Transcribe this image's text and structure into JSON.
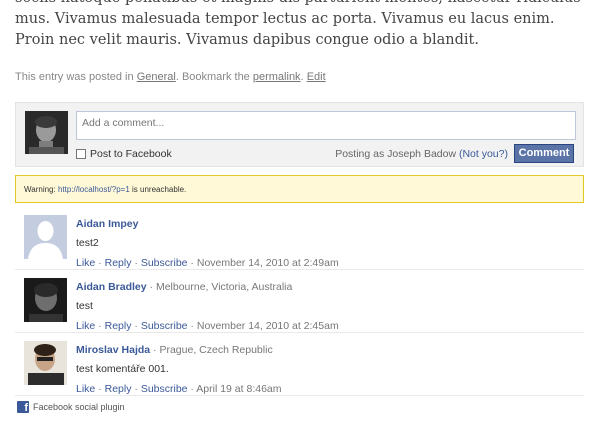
{
  "post": {
    "paragraph": "sociis natoque penatibus et magnis dis parturient montes, nascetur ridiculus mus. Vivamus malesuada tempor lectus ac porta. Vivamus eu lacus enim. Proin nec velit mauris. Vivamus dapibus congue odio a blandit."
  },
  "entry_meta": {
    "prefix": "This entry was posted in",
    "category": "General",
    "middle": ". Bookmark the",
    "permalink": "permalink",
    "dot": ".",
    "edit": "Edit"
  },
  "fb_comment_box": {
    "placeholder": "Add a comment...",
    "post_to_facebook": "Post to Facebook",
    "posting_as_prefix": "Posting as Joseph Badow",
    "not_you": "(Not you?)",
    "comment_button": "Comment"
  },
  "warning": {
    "prefix": "Warning:",
    "url": "http://localhost/?p=1",
    "suffix": "is unreachable."
  },
  "comments": [
    {
      "name": "Aidan Impey",
      "location": "",
      "text": "test2",
      "like": "Like",
      "reply": "Reply",
      "subscribe": "Subscribe",
      "time": "November 14, 2010 at 2:49am",
      "avatar": "default-silhouette"
    },
    {
      "name": "Aidan Bradley",
      "location": "· Melbourne, Victoria, Australia",
      "text": "test",
      "like": "Like",
      "reply": "Reply",
      "subscribe": "Subscribe",
      "time": "November 14, 2010 at 2:45am",
      "avatar": "photo"
    },
    {
      "name": "Miroslav Hajda",
      "location": "· Prague, Czech Republic",
      "text": "test komentáře 001.",
      "like": "Like",
      "reply": "Reply",
      "subscribe": "Subscribe",
      "time": "April 19 at 8:46am",
      "avatar": "photo"
    }
  ],
  "footer": {
    "label": "Facebook social plugin",
    "logo_letter": "f"
  },
  "colors": {
    "fb_blue": "#3b5998",
    "button_blue": "#5b74a8",
    "warning_bg": "#fff9d7",
    "warning_border": "#e2c822"
  }
}
